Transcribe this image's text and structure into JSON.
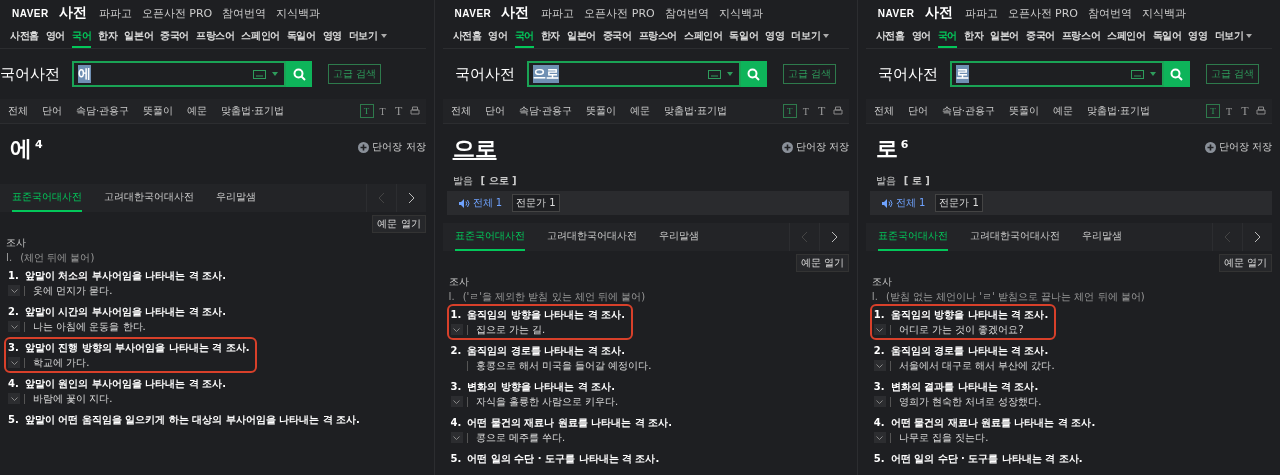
{
  "panels": [
    {
      "brand": "NAVER",
      "service": "사전",
      "top_links": [
        "파파고",
        "오픈사전 PRO",
        "참여번역",
        "지식백과"
      ],
      "categories": [
        {
          "label": "사전홈",
          "selected": false
        },
        {
          "label": "영어",
          "selected": false
        },
        {
          "label": "국어",
          "selected": true
        },
        {
          "label": "한자",
          "selected": false
        },
        {
          "label": "일본어",
          "selected": false
        },
        {
          "label": "중국어",
          "selected": false
        },
        {
          "label": "프랑스어",
          "selected": false
        },
        {
          "label": "스페인어",
          "selected": false
        },
        {
          "label": "독일어",
          "selected": false
        },
        {
          "label": "영영",
          "selected": false
        }
      ],
      "more": "더보기",
      "dict_title": "국어사전",
      "query": "에",
      "query_highlighted": true,
      "advanced_search": "고급 검색",
      "filters": [
        "전체",
        "단어",
        "속담·관용구",
        "뜻풀이",
        "예문",
        "맞춤법·표기법"
      ],
      "font_sizes": [
        {
          "label": "T",
          "selected": true
        },
        {
          "label": "T",
          "selected": false
        },
        {
          "label": "T",
          "selected": false
        }
      ],
      "save_word": "단어장 저장",
      "headword": "에",
      "underlined": false,
      "homograph": "4",
      "source_tabs": [
        {
          "label": "표준국어대사전",
          "selected": true
        },
        {
          "label": "고려대한국어대사전",
          "selected": false
        },
        {
          "label": "우리말샘",
          "selected": false
        }
      ],
      "examples_toggle": "예문 열기",
      "pos": "조사",
      "usage_number": "I.",
      "usage": "(체언 뒤에 붙어)",
      "senses": [
        {
          "number": "1.",
          "definition": "앞말이 처소의 부사어임을 나타내는 격 조사.",
          "example": "옷에 먼지가 묻다.",
          "expandable": true,
          "highlighted": false
        },
        {
          "number": "2.",
          "definition": "앞말이 시간의 부사어임을 나타내는 격 조사.",
          "example": "나는 아침에 운동을 한다.",
          "expandable": true,
          "highlighted": false
        },
        {
          "number": "3.",
          "definition": "앞말이 진행 방향의 부사어임을 나타내는 격 조사.",
          "example": "학교에 가다.",
          "expandable": true,
          "highlighted": true
        },
        {
          "number": "4.",
          "definition": "앞말이 원인의 부사어임을 나타내는 격 조사.",
          "example": "바람에 꽃이 지다.",
          "expandable": true,
          "highlighted": false
        },
        {
          "number": "5.",
          "definition": "앞말이 어떤 움직임을 일으키게 하는 대상의 부사어임을 나타내는 격 조사.",
          "highlighted": false
        }
      ]
    },
    {
      "brand": "NAVER",
      "service": "사전",
      "top_links": [
        "파파고",
        "오픈사전 PRO",
        "참여번역",
        "지식백과"
      ],
      "categories": [
        {
          "label": "사전홈",
          "selected": false
        },
        {
          "label": "영어",
          "selected": false
        },
        {
          "label": "국어",
          "selected": true
        },
        {
          "label": "한자",
          "selected": false
        },
        {
          "label": "일본어",
          "selected": false
        },
        {
          "label": "중국어",
          "selected": false
        },
        {
          "label": "프랑스어",
          "selected": false
        },
        {
          "label": "스페인어",
          "selected": false
        },
        {
          "label": "독일어",
          "selected": false
        },
        {
          "label": "영영",
          "selected": false
        }
      ],
      "more": "더보기",
      "dict_title": "국어사전",
      "query": "으로",
      "query_highlighted": true,
      "advanced_search": "고급 검색",
      "filters": [
        "전체",
        "단어",
        "속담·관용구",
        "뜻풀이",
        "예문",
        "맞춤법·표기법"
      ],
      "font_sizes": [
        {
          "label": "T",
          "selected": true
        },
        {
          "label": "T",
          "selected": false
        },
        {
          "label": "T",
          "selected": false
        }
      ],
      "save_word": "단어장 저장",
      "headword": "으로",
      "underlined": true,
      "pronunciation": {
        "label": "발음",
        "value": "[ 으로 ]",
        "all": "전체 1",
        "expert": "전문가 1"
      },
      "source_tabs": [
        {
          "label": "표준국어대사전",
          "selected": true
        },
        {
          "label": "고려대한국어대사전",
          "selected": false
        },
        {
          "label": "우리말샘",
          "selected": false
        }
      ],
      "examples_toggle": "예문 열기",
      "pos": "조사",
      "usage_number": "I.",
      "usage": "('ㄹ'을 제외한 받침 있는 체언 뒤에 붙어)",
      "senses": [
        {
          "number": "1.",
          "definition": "움직임의 방향을 나타내는 격 조사.",
          "example": "집으로 가는 길.",
          "expandable": true,
          "highlighted": true
        },
        {
          "number": "2.",
          "definition": "움직임의 경로를 나타내는 격 조사.",
          "example": "홍콩으로 해서 미국을 들어갈 예정이다.",
          "expandable": false,
          "highlighted": false
        },
        {
          "number": "3.",
          "definition": "변화의 방향을 나타내는 격 조사.",
          "example": "자식을 훌륭한 사람으로 키우다.",
          "expandable": true,
          "highlighted": false
        },
        {
          "number": "4.",
          "definition": "어떤 물건의 재료나 원료를 나타내는 격 조사.",
          "example": "콩으로 메주를 쑤다.",
          "expandable": true,
          "highlighted": false
        },
        {
          "number": "5.",
          "definition": "어떤 일의 수단 · 도구를 나타내는 격 조사.",
          "highlighted": false
        }
      ]
    },
    {
      "brand": "NAVER",
      "service": "사전",
      "top_links": [
        "파파고",
        "오픈사전 PRO",
        "참여번역",
        "지식백과"
      ],
      "categories": [
        {
          "label": "사전홈",
          "selected": false
        },
        {
          "label": "영어",
          "selected": false
        },
        {
          "label": "국어",
          "selected": true
        },
        {
          "label": "한자",
          "selected": false
        },
        {
          "label": "일본어",
          "selected": false
        },
        {
          "label": "중국어",
          "selected": false
        },
        {
          "label": "프랑스어",
          "selected": false
        },
        {
          "label": "스페인어",
          "selected": false
        },
        {
          "label": "독일어",
          "selected": false
        },
        {
          "label": "영영",
          "selected": false
        }
      ],
      "more": "더보기",
      "dict_title": "국어사전",
      "query": "로",
      "query_highlighted": true,
      "advanced_search": "고급 검색",
      "filters": [
        "전체",
        "단어",
        "속담·관용구",
        "뜻풀이",
        "예문",
        "맞춤법·표기법"
      ],
      "font_sizes": [
        {
          "label": "T",
          "selected": true
        },
        {
          "label": "T",
          "selected": false
        },
        {
          "label": "T",
          "selected": false
        }
      ],
      "save_word": "단어장 저장",
      "headword": "로",
      "underlined": false,
      "homograph": "6",
      "pronunciation": {
        "label": "발음",
        "value": "[ 로 ]",
        "all": "전체 1",
        "expert": "전문가 1"
      },
      "source_tabs": [
        {
          "label": "표준국어대사전",
          "selected": true
        },
        {
          "label": "고려대한국어대사전",
          "selected": false
        },
        {
          "label": "우리말샘",
          "selected": false
        }
      ],
      "examples_toggle": "예문 열기",
      "pos": "조사",
      "usage_number": "I.",
      "usage": "(받침 없는 체언이나 'ㄹ' 받침으로 끝나는 체언 뒤에 붙어)",
      "senses": [
        {
          "number": "1.",
          "definition": "움직임의 방향을 나타내는 격 조사.",
          "example": "어디로 가는 것이 좋겠어요?",
          "expandable": true,
          "highlighted": true
        },
        {
          "number": "2.",
          "definition": "움직임의 경로를 나타내는 격 조사.",
          "example": "서울에서 대구로 해서 부산에 갔다.",
          "expandable": true,
          "highlighted": false
        },
        {
          "number": "3.",
          "definition": "변화의 결과를 나타내는 격 조사.",
          "example": "영희가 현숙한 처녀로 성장했다.",
          "expandable": true,
          "highlighted": false
        },
        {
          "number": "4.",
          "definition": "어떤 물건의 재료나 원료를 나타내는 격 조사.",
          "example": "나무로 집을 짓는다.",
          "expandable": true,
          "highlighted": false
        },
        {
          "number": "5.",
          "definition": "어떤 일의 수단 · 도구를 나타내는 격 조사.",
          "highlighted": false
        }
      ]
    }
  ]
}
